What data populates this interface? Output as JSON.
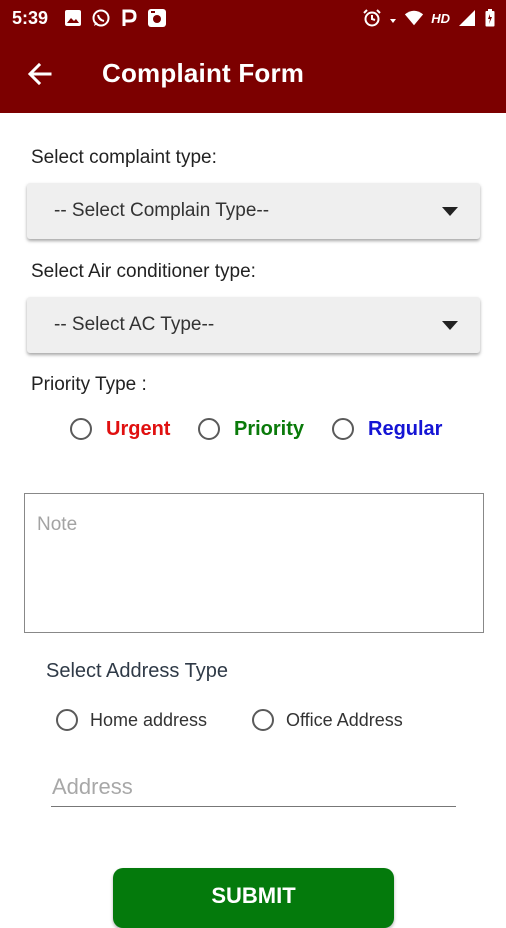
{
  "status_bar": {
    "time": "5:39",
    "left_icons": [
      "image-icon",
      "whatsapp-icon",
      "p-icon",
      "camera-icon"
    ],
    "network_label": "HD"
  },
  "app_bar": {
    "title": "Complaint Form"
  },
  "form": {
    "complaint_type_label": "Select complaint type:",
    "complaint_type_value": "-- Select Complain Type--",
    "ac_type_label": "Select Air conditioner type:",
    "ac_type_value": "-- Select AC Type--",
    "priority_label": "Priority Type :",
    "priority_options": [
      {
        "label": "Urgent",
        "color": "#e01010"
      },
      {
        "label": "Priority",
        "color": "#0a7a0a"
      },
      {
        "label": "Regular",
        "color": "#1414d4"
      }
    ],
    "note_placeholder": "Note",
    "address_type_label": "Select Address Type",
    "address_options": [
      {
        "label": "Home address"
      },
      {
        "label": "Office Address"
      }
    ],
    "address_placeholder": "Address",
    "submit_label": "SUBMIT"
  },
  "colors": {
    "primary": "#7c0000",
    "submit": "#047a0c"
  }
}
